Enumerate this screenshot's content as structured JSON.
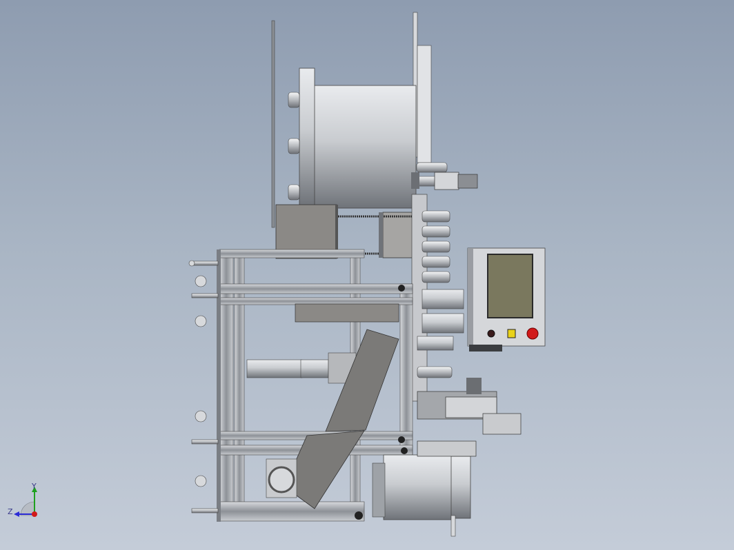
{
  "viewport": {
    "background_top": "#8e9cb0",
    "background_bottom": "#c4ccd8"
  },
  "model": {
    "description_icon": "cad-assembly-side-view",
    "main_color": "#b8babd",
    "frame_color": "#9ea2a7",
    "panel_screen_color": "#7a785e"
  },
  "control_panel": {
    "buttons": [
      {
        "name": "black-button",
        "color": "#3a1b1b"
      },
      {
        "name": "yellow-button",
        "color": "#e9d21a"
      },
      {
        "name": "emergency-stop",
        "color": "#d11a1a"
      }
    ]
  },
  "triad": {
    "x_label": "",
    "y_label": "Y",
    "z_label": "Z",
    "y_color": "#1fa01f",
    "z_color": "#2b2bd6",
    "origin_color": "#d11a1a"
  }
}
